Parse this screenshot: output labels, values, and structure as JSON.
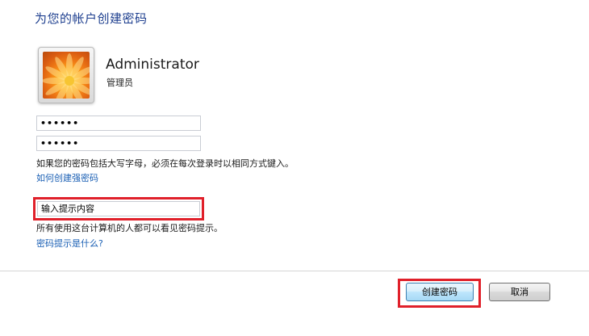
{
  "header": {
    "title": "为您的帐户创建密码"
  },
  "user": {
    "name": "Administrator",
    "role": "管理员"
  },
  "form": {
    "password_value": "••••••",
    "confirm_value": "••••••",
    "case_note": "如果您的密码包括大写字母，必须在每次登录时以相同方式键入。",
    "strong_link": "如何创建强密码",
    "hint_value": "输入提示内容",
    "hint_note": "所有使用这台计算机的人都可以看见密码提示。",
    "hint_link": "密码提示是什么?"
  },
  "buttons": {
    "create_label": "创建密码",
    "cancel_label": "取消"
  },
  "colors": {
    "title": "#1e3f8f",
    "link": "#1a5fb4",
    "highlight": "#e0202a"
  },
  "icons": {
    "avatar": "flower-avatar-icon"
  }
}
